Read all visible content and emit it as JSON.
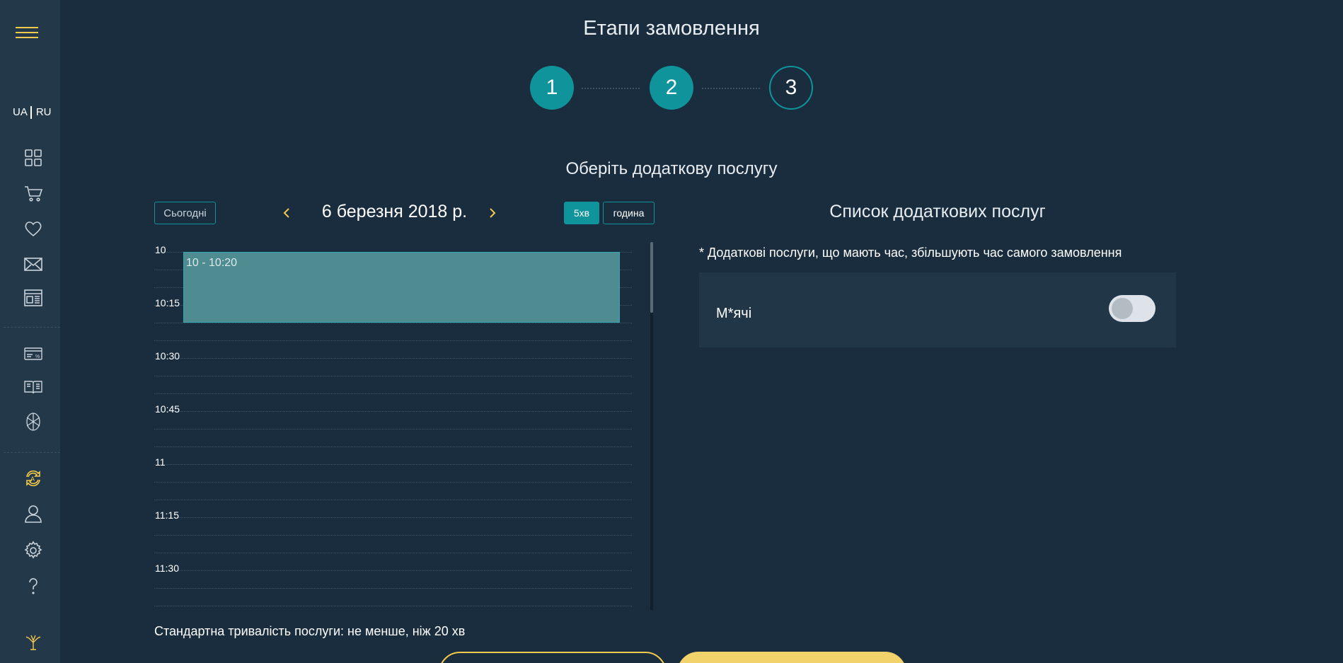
{
  "page": {
    "title": "Етапи замовлення",
    "subtitle": "Оберіть додаткову послугу"
  },
  "sidebar": {
    "lang_ua": "UA",
    "lang_ru": "RU",
    "icons": [
      "menu-icon",
      "grid-icon",
      "cart-icon",
      "heart-icon",
      "envelope-icon",
      "layout-icon",
      "card-discount-icon",
      "book-icon",
      "flower-icon",
      "refresh-a-icon",
      "user-icon",
      "gear-icon",
      "question-icon",
      "tree-logo-icon"
    ],
    "accent_color": "#f2c94c"
  },
  "steps": [
    {
      "number": "1",
      "state": "done"
    },
    {
      "number": "2",
      "state": "done"
    },
    {
      "number": "3",
      "state": "current"
    }
  ],
  "calendar": {
    "today_label": "Сьогодні",
    "date": "6 березня 2018 р.",
    "view_5min": "5хв",
    "view_hour": "година",
    "time_labels": [
      "10",
      "10:15",
      "10:30",
      "10:45",
      "11",
      "11:15",
      "11:30"
    ],
    "event": {
      "label": "10 - 10:20",
      "start": "10:00",
      "end": "10:20"
    },
    "duration_note": "Стандартна тривалість послуги: не менше, ніж 20 хв",
    "accent_color": "#0f949b"
  },
  "services": {
    "title": "Список додаткових послуг",
    "note": "* Додаткові послуги, що мають час, збільшують час самого замовлення",
    "items": [
      {
        "name": "М*ячі",
        "enabled": false
      }
    ]
  }
}
